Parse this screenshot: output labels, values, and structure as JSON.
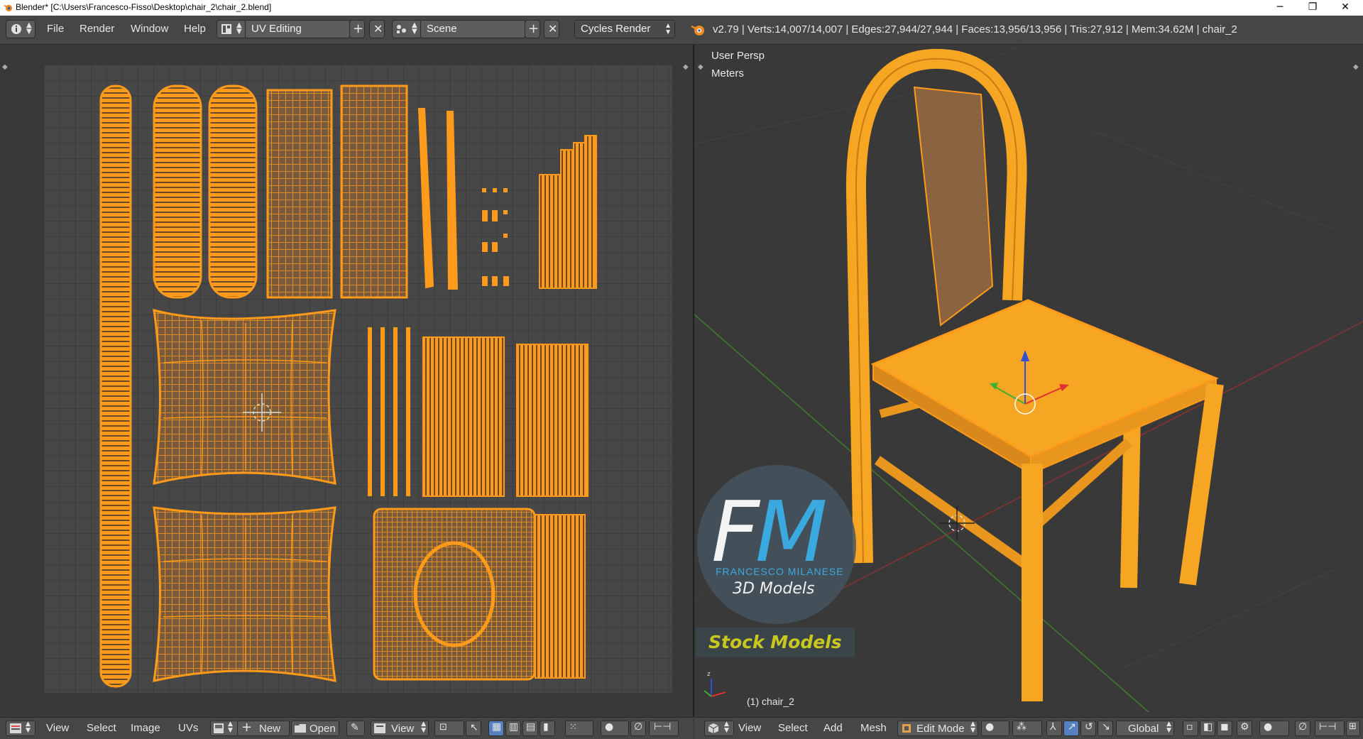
{
  "window": {
    "title": "Blender* [C:\\Users\\Francesco-Fisso\\Desktop\\chair_2\\chair_2.blend]",
    "minimize": "─",
    "restore": "❐",
    "close": "✕"
  },
  "info_header": {
    "menus": [
      "File",
      "Render",
      "Window",
      "Help"
    ],
    "layout": "UV Editing",
    "scene": "Scene",
    "engine": "Cycles Render",
    "stats": "v2.79 | Verts:14,007/14,007 | Edges:27,944/27,944 | Faces:13,956/13,956 | Tris:27,912 | Mem:34.62M | chair_2"
  },
  "image_editor_footer": {
    "menus": [
      "View",
      "Select",
      "Image",
      "UVs"
    ],
    "new_label": "New",
    "open_label": "Open",
    "view_label": "View"
  },
  "viewport": {
    "view_name": "User Persp",
    "units": "Meters",
    "object_label": "(1) chair_2"
  },
  "viewport_footer": {
    "menus": [
      "View",
      "Select",
      "Add",
      "Mesh"
    ],
    "mode": "Edit Mode",
    "orientation": "Global"
  },
  "watermark": {
    "logo_text": "FM",
    "name": "FRANCESCO MILANESE",
    "tagline": "3D Models",
    "badge": "Stock Models"
  },
  "colors": {
    "wire": "#ff9a1a",
    "face_fill": "#7a5a3c",
    "chair_fill": "#f6a623",
    "accent_blue": "#5680c2",
    "logo_blue": "#3aa9e0",
    "badge_yellow": "#c8c81e"
  },
  "icons": [
    "info-icon",
    "screen-layout-icon",
    "scene-icon",
    "blender-logo-icon",
    "editor-type-icon",
    "image-browse-icon",
    "pin-icon",
    "uv-select-mode-icons",
    "pivot-icon",
    "snap-icon",
    "viewport-shading-icon",
    "manipulator-icons",
    "mesh-select-mode-icons",
    "proportional-edit-icon"
  ]
}
